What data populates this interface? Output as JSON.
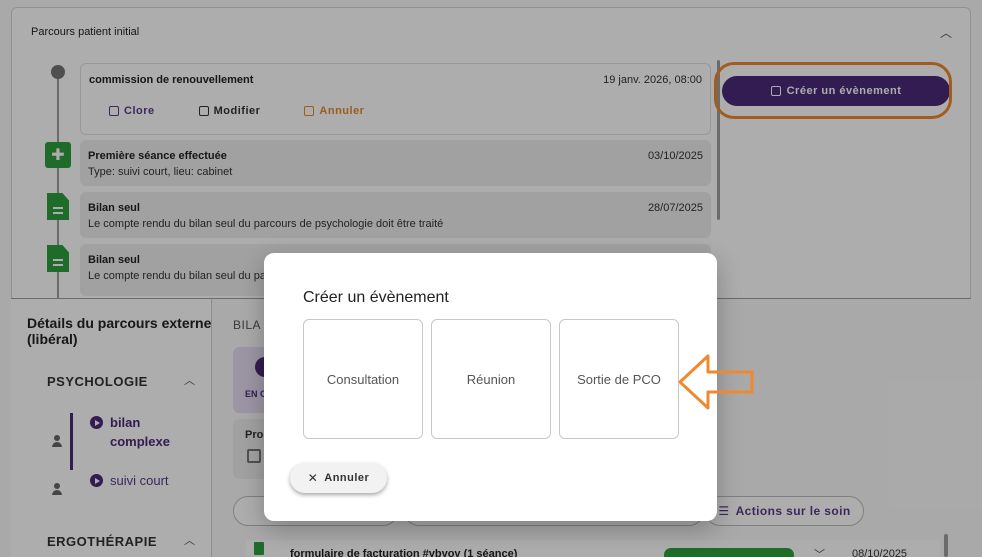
{
  "card": {
    "title": "Parcours patient initial",
    "events": [
      {
        "title": "commission de renouvellement",
        "date": "19 janv. 2026, 08:00",
        "subtitle": ""
      },
      {
        "title": "Première séance effectuée",
        "date": "03/10/2025",
        "subtitle": "Type: suivi court, lieu: cabinet"
      },
      {
        "title": "Bilan seul",
        "date": "28/07/2025",
        "subtitle": "Le compte rendu du bilan seul du parcours de psychologie doit être traité"
      },
      {
        "title": "Bilan seul",
        "date": "",
        "subtitle": "Le compte rendu du bilan seul du parcours de psychologie doit être traité"
      }
    ],
    "actions": {
      "close": "Clore",
      "edit": "Modifier",
      "cancel": "Annuler"
    },
    "create_button": "Créer un évènement"
  },
  "external": {
    "title": "Détails du parcours externe (libéral)",
    "sections": [
      {
        "label": "PSYCHOLOGIE",
        "items": [
          "bilan complexe",
          "suivi court"
        ]
      },
      {
        "label": "ERGOTHÉRAPIE",
        "items": []
      }
    ]
  },
  "main": {
    "section_label": "BILA",
    "status_label": "EN C",
    "card_label": "Pro",
    "actions_button": "Actions sur le soin",
    "list_row": {
      "title": "formulaire de facturation #ybyoy (1 séance)",
      "date": "08/10/2025"
    }
  },
  "dialog": {
    "title": "Créer un évènement",
    "options": [
      "Consultation",
      "Réunion",
      "Sortie de PCO"
    ],
    "cancel_label": "Annuler"
  },
  "colors": {
    "primary": "#4a2a7a",
    "accent_orange": "#f0882f",
    "success": "#2e9e3e"
  }
}
